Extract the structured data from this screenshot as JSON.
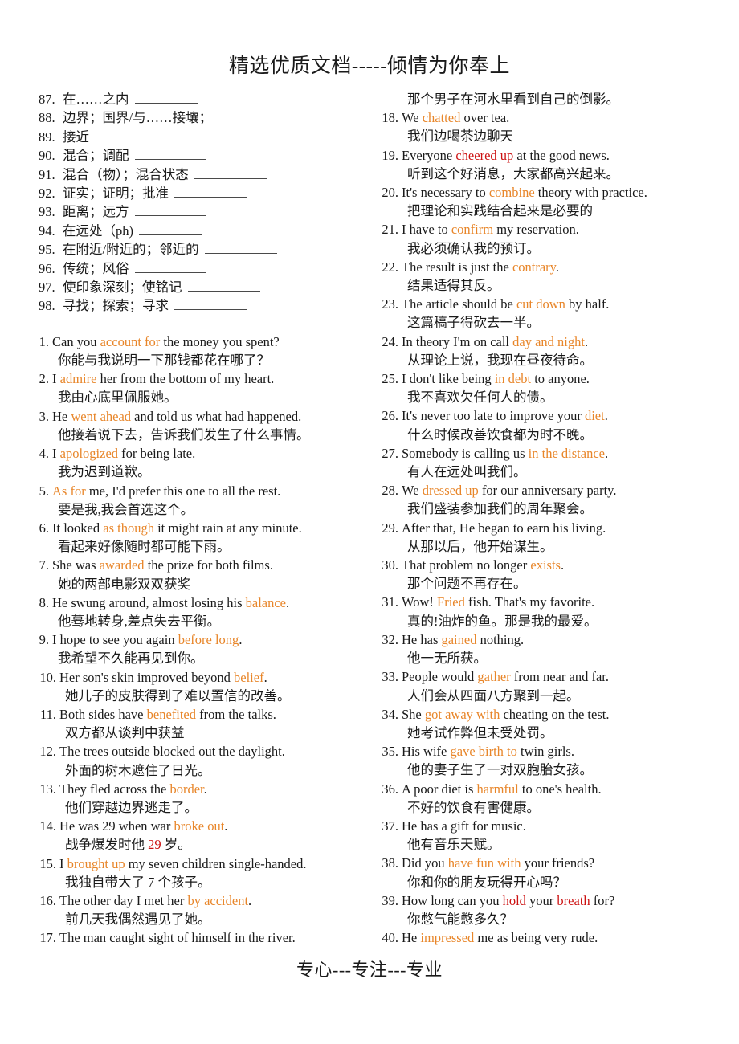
{
  "header": {
    "title": "精选优质文档-----倾情为你奉上"
  },
  "footer": {
    "text": "专心---专注---专业"
  },
  "vocabulary": [
    {
      "num": "87.",
      "term": "在……之内",
      "blank_width": 78
    },
    {
      "num": "88.",
      "term": "边界；国界/与……接壤；",
      "blank_width": 0
    },
    {
      "num": "89.",
      "term": "接近",
      "blank_width": 88
    },
    {
      "num": "90.",
      "term": "混合；调配",
      "blank_width": 88
    },
    {
      "num": "91.",
      "term": "混合（物）；混合状态",
      "blank_width": 90
    },
    {
      "num": "92.",
      "term": "证实；证明；批准",
      "blank_width": 90
    },
    {
      "num": "93.",
      "term": "距离；远方",
      "blank_width": 88
    },
    {
      "num": "94.",
      "term": "在远处（ph)",
      "blank_width": 78
    },
    {
      "num": "95.",
      "term": "在附近/附近的；邻近的",
      "blank_width": 90
    },
    {
      "num": "96.",
      "term": "传统；风俗",
      "blank_width": 88
    },
    {
      "num": "97.",
      "term": "使印象深刻；使铭记",
      "blank_width": 90
    },
    {
      "num": "98.",
      "term": "寻找；探索；寻求",
      "blank_width": 90
    }
  ],
  "left_sentences": [
    {
      "num": "1.",
      "en": [
        {
          "t": "Can you ",
          "c": "k"
        },
        {
          "t": "account for",
          "c": "o"
        },
        {
          "t": " the money you spent?",
          "c": "k"
        }
      ],
      "zh": [
        {
          "t": "你能与我说明一下那钱都花在哪了？",
          "c": "k"
        }
      ]
    },
    {
      "num": "2.",
      "en": [
        {
          "t": "I ",
          "c": "k"
        },
        {
          "t": "admire",
          "c": "o"
        },
        {
          "t": " her from the bottom of my heart.",
          "c": "k"
        }
      ],
      "zh": [
        {
          "t": "我由心底里佩服她。",
          "c": "k"
        }
      ]
    },
    {
      "num": "3.",
      "en": [
        {
          "t": "He ",
          "c": "k"
        },
        {
          "t": "went ahead",
          "c": "o"
        },
        {
          "t": " and told us what had happened.",
          "c": "k"
        }
      ],
      "zh": [
        {
          "t": "他接着说下去，告诉我们发生了什么事情。",
          "c": "k"
        }
      ]
    },
    {
      "num": "4.",
      "en": [
        {
          "t": "I ",
          "c": "k"
        },
        {
          "t": "apologized",
          "c": "o"
        },
        {
          "t": " for being late.",
          "c": "k"
        }
      ],
      "zh": [
        {
          "t": "我为迟到道歉。",
          "c": "k"
        }
      ]
    },
    {
      "num": "5.",
      "en": [
        {
          "t": "As for",
          "c": "o"
        },
        {
          "t": " me, I'd prefer this one to all the rest.",
          "c": "k"
        }
      ],
      "zh": [
        {
          "t": "要是我,我会首选这个。",
          "c": "k"
        }
      ]
    },
    {
      "num": "6.",
      "en": [
        {
          "t": "It looked ",
          "c": "k"
        },
        {
          "t": "as though",
          "c": "o"
        },
        {
          "t": " it might rain at any minute.",
          "c": "k"
        }
      ],
      "zh": [
        {
          "t": "看起来好像随时都可能下雨。",
          "c": "k"
        }
      ]
    },
    {
      "num": "7.",
      "en": [
        {
          "t": "She was ",
          "c": "k"
        },
        {
          "t": "awarded",
          "c": "o"
        },
        {
          "t": " the prize for both films.",
          "c": "k"
        }
      ],
      "zh": [
        {
          "t": "她的两部电影双双获奖",
          "c": "k"
        }
      ]
    },
    {
      "num": "8.",
      "en": [
        {
          "t": "He swung around, almost losing his ",
          "c": "k"
        },
        {
          "t": "balance",
          "c": "o"
        },
        {
          "t": ".",
          "c": "k"
        }
      ],
      "zh": [
        {
          "t": "他蓦地转身,差点失去平衡。",
          "c": "k"
        }
      ]
    },
    {
      "num": "9.",
      "en": [
        {
          "t": "I hope to see you again ",
          "c": "k"
        },
        {
          "t": "before long",
          "c": "o"
        },
        {
          "t": ".",
          "c": "k"
        }
      ],
      "zh": [
        {
          "t": "我希望不久能再见到你。",
          "c": "k"
        }
      ]
    },
    {
      "num": "10.",
      "en": [
        {
          "t": "Her son's skin improved beyond ",
          "c": "k"
        },
        {
          "t": "belief",
          "c": "o"
        },
        {
          "t": ".",
          "c": "k"
        }
      ],
      "zh": [
        {
          "t": "她儿子的皮肤得到了难以置信的改善。",
          "c": "k"
        }
      ]
    },
    {
      "num": "11.",
      "en": [
        {
          "t": "Both sides have ",
          "c": "k"
        },
        {
          "t": "benefited",
          "c": "o"
        },
        {
          "t": " from the talks.",
          "c": "k"
        }
      ],
      "zh": [
        {
          "t": "双方都从谈判中获益",
          "c": "k"
        }
      ]
    },
    {
      "num": "12.",
      "en": [
        {
          "t": "The trees outside blocked out the daylight.",
          "c": "k"
        }
      ],
      "zh": [
        {
          "t": "外面的树木遮住了日光。",
          "c": "k"
        }
      ]
    },
    {
      "num": "13.",
      "en": [
        {
          "t": "They fled across the ",
          "c": "k"
        },
        {
          "t": "border",
          "c": "o"
        },
        {
          "t": ".",
          "c": "k"
        }
      ],
      "zh": [
        {
          "t": "他们穿越边界逃走了。",
          "c": "k"
        }
      ]
    },
    {
      "num": "14.",
      "en": [
        {
          "t": "He was 29 when war ",
          "c": "k"
        },
        {
          "t": "broke out",
          "c": "o"
        },
        {
          "t": ".",
          "c": "k"
        }
      ],
      "zh": [
        {
          "t": "战争爆发时他 ",
          "c": "k"
        },
        {
          "t": "29",
          "c": "r"
        },
        {
          "t": " 岁。",
          "c": "k"
        }
      ]
    },
    {
      "num": "15.",
      "en": [
        {
          "t": "I ",
          "c": "k"
        },
        {
          "t": "brought up",
          "c": "o"
        },
        {
          "t": " my seven children single-handed.",
          "c": "k"
        }
      ],
      "zh": [
        {
          "t": "我独自带大了 7 个孩子。",
          "c": "k"
        }
      ]
    },
    {
      "num": "16.",
      "en": [
        {
          "t": "The other day I met her ",
          "c": "k"
        },
        {
          "t": "by accident",
          "c": "o"
        },
        {
          "t": ".",
          "c": "k"
        }
      ],
      "zh": [
        {
          "t": "前几天我偶然遇见了她。",
          "c": "k"
        }
      ]
    },
    {
      "num": "17.",
      "en": [
        {
          "t": "The man caught sight of himself in the river.",
          "c": "k"
        }
      ],
      "zh": []
    }
  ],
  "right_continuation": {
    "zh": "那个男子在河水里看到自己的倒影。"
  },
  "right_sentences": [
    {
      "num": "18.",
      "en": [
        {
          "t": "We ",
          "c": "k"
        },
        {
          "t": "chatted",
          "c": "o"
        },
        {
          "t": " over tea.",
          "c": "k"
        }
      ],
      "zh": [
        {
          "t": "我们边喝茶边聊天",
          "c": "k"
        }
      ]
    },
    {
      "num": "19.",
      "en": [
        {
          "t": "Everyone ",
          "c": "k"
        },
        {
          "t": "cheered up",
          "c": "r"
        },
        {
          "t": " at the good news.",
          "c": "k"
        }
      ],
      "zh": [
        {
          "t": "听到这个好消息，大家都高兴起来。",
          "c": "k"
        }
      ]
    },
    {
      "num": "20.",
      "en": [
        {
          "t": "It's necessary to ",
          "c": "k"
        },
        {
          "t": "combine",
          "c": "o"
        },
        {
          "t": " theory with practice.",
          "c": "k"
        }
      ],
      "zh": [
        {
          "t": "把理论和实践结合起来是必要的",
          "c": "k"
        }
      ]
    },
    {
      "num": "21.",
      "en": [
        {
          "t": "I have to ",
          "c": "k"
        },
        {
          "t": "confirm",
          "c": "o"
        },
        {
          "t": " my reservation.",
          "c": "k"
        }
      ],
      "zh": [
        {
          "t": "我必须确认我的预订。",
          "c": "k"
        }
      ]
    },
    {
      "num": "22.",
      "en": [
        {
          "t": "The result is just the ",
          "c": "k"
        },
        {
          "t": "contrary",
          "c": "o"
        },
        {
          "t": ".",
          "c": "k"
        }
      ],
      "zh": [
        {
          "t": "结果适得其反。",
          "c": "k"
        }
      ]
    },
    {
      "num": "23.",
      "en": [
        {
          "t": "The article should be ",
          "c": "k"
        },
        {
          "t": "cut down",
          "c": "o"
        },
        {
          "t": " by half.",
          "c": "k"
        }
      ],
      "zh": [
        {
          "t": "这篇稿子得砍去一半。",
          "c": "k"
        }
      ]
    },
    {
      "num": "24.",
      "en": [
        {
          "t": "In theory I'm on call ",
          "c": "k"
        },
        {
          "t": "day and night",
          "c": "o"
        },
        {
          "t": ".",
          "c": "k"
        }
      ],
      "zh": [
        {
          "t": "从理论上说，我现在昼夜待命。",
          "c": "k"
        }
      ]
    },
    {
      "num": "25.",
      "en": [
        {
          "t": "I don't like being ",
          "c": "k"
        },
        {
          "t": "in debt",
          "c": "o"
        },
        {
          "t": " to anyone.",
          "c": "k"
        }
      ],
      "zh": [
        {
          "t": "我不喜欢欠任何人的债。",
          "c": "k"
        }
      ]
    },
    {
      "num": "26.",
      "en": [
        {
          "t": "It's never too late to improve your ",
          "c": "k"
        },
        {
          "t": "diet",
          "c": "o"
        },
        {
          "t": ".",
          "c": "k"
        }
      ],
      "zh": [
        {
          "t": "什么时候改善饮食都为时不晚。",
          "c": "k"
        }
      ]
    },
    {
      "num": "27.",
      "en": [
        {
          "t": "Somebody is calling us ",
          "c": "k"
        },
        {
          "t": "in the distance",
          "c": "o"
        },
        {
          "t": ".",
          "c": "k"
        }
      ],
      "zh": [
        {
          "t": "有人在远处叫我们。",
          "c": "k"
        }
      ]
    },
    {
      "num": "28.",
      "en": [
        {
          "t": "We ",
          "c": "k"
        },
        {
          "t": "dressed up",
          "c": "o"
        },
        {
          "t": " for our anniversary party.",
          "c": "k"
        }
      ],
      "zh": [
        {
          "t": "我们盛装参加我们的周年聚会。",
          "c": "k"
        }
      ]
    },
    {
      "num": "29.",
      "en": [
        {
          "t": "After that, He began to earn his living.",
          "c": "k"
        }
      ],
      "zh": [
        {
          "t": "从那以后，他开始谋生。",
          "c": "k"
        }
      ]
    },
    {
      "num": "30.",
      "en": [
        {
          "t": "That problem no longer ",
          "c": "k"
        },
        {
          "t": "exists",
          "c": "o"
        },
        {
          "t": ".",
          "c": "k"
        }
      ],
      "zh": [
        {
          "t": "那个问题不再存在。",
          "c": "k"
        }
      ]
    },
    {
      "num": "31.",
      "en": [
        {
          "t": "Wow! ",
          "c": "k"
        },
        {
          "t": "Fried",
          "c": "o"
        },
        {
          "t": " fish. That's my favorite.",
          "c": "k"
        }
      ],
      "zh": [
        {
          "t": "真的!油炸的鱼。那是我的最爱。",
          "c": "k"
        }
      ]
    },
    {
      "num": "32.",
      "en": [
        {
          "t": "He has ",
          "c": "k"
        },
        {
          "t": "gained",
          "c": "o"
        },
        {
          "t": " nothing.",
          "c": "k"
        }
      ],
      "zh": [
        {
          "t": "他一无所获。",
          "c": "k"
        }
      ]
    },
    {
      "num": "33.",
      "en": [
        {
          "t": "People would ",
          "c": "k"
        },
        {
          "t": "gather",
          "c": "o"
        },
        {
          "t": " from near and far.",
          "c": "k"
        }
      ],
      "zh": [
        {
          "t": "人们会从四面八方聚到一起。",
          "c": "k"
        }
      ]
    },
    {
      "num": "34.",
      "en": [
        {
          "t": "She ",
          "c": "k"
        },
        {
          "t": "got away with",
          "c": "o"
        },
        {
          "t": " cheating on the test.",
          "c": "k"
        }
      ],
      "zh": [
        {
          "t": "她考试作弊但未受处罚。",
          "c": "k"
        }
      ]
    },
    {
      "num": "35.",
      "en": [
        {
          "t": "His wife ",
          "c": "k"
        },
        {
          "t": "gave birth to",
          "c": "o"
        },
        {
          "t": " twin girls.",
          "c": "k"
        }
      ],
      "zh": [
        {
          "t": "他的妻子生了一对双胞胎女孩。",
          "c": "k"
        }
      ]
    },
    {
      "num": "36.",
      "en": [
        {
          "t": "A poor diet is ",
          "c": "k"
        },
        {
          "t": "harmful",
          "c": "o"
        },
        {
          "t": " to one's health.",
          "c": "k"
        }
      ],
      "zh": [
        {
          "t": "不好的饮食有害健康。",
          "c": "k"
        }
      ]
    },
    {
      "num": "37.",
      "en": [
        {
          "t": "He has a gift for music.",
          "c": "k"
        }
      ],
      "zh": [
        {
          "t": "他有音乐天赋。",
          "c": "k"
        }
      ]
    },
    {
      "num": "38.",
      "en": [
        {
          "t": "Did you ",
          "c": "k"
        },
        {
          "t": "have fun with",
          "c": "o"
        },
        {
          "t": " your friends?",
          "c": "k"
        }
      ],
      "zh": [
        {
          "t": "你和你的朋友玩得开心吗？",
          "c": "k"
        }
      ]
    },
    {
      "num": "39.",
      "en": [
        {
          "t": "How long can you ",
          "c": "k"
        },
        {
          "t": "hold",
          "c": "r"
        },
        {
          "t": " your ",
          "c": "k"
        },
        {
          "t": "breath",
          "c": "r"
        },
        {
          "t": " for?",
          "c": "k"
        }
      ],
      "zh": [
        {
          "t": "你憋气能憋多久？",
          "c": "k"
        }
      ]
    },
    {
      "num": "40.",
      "en": [
        {
          "t": "He ",
          "c": "k"
        },
        {
          "t": "impressed",
          "c": "o"
        },
        {
          "t": " me as being very rude.",
          "c": "k"
        }
      ],
      "zh": []
    }
  ],
  "colors": {
    "highlight_orange": "#E8862A",
    "highlight_red": "#CC1111",
    "text": "#1a1a1a"
  }
}
